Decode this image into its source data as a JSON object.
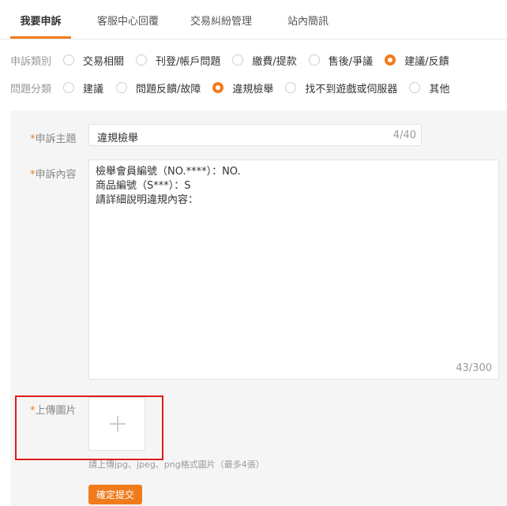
{
  "tabs": [
    {
      "label": "我要申訴",
      "active": true
    },
    {
      "label": "客服中心回覆",
      "active": false
    },
    {
      "label": "交易糾紛管理",
      "active": false
    },
    {
      "label": "站內簡訊",
      "active": false
    }
  ],
  "category": {
    "label": "申訴類別",
    "options": [
      "交易相關",
      "刊登/帳戶問題",
      "繳費/提款",
      "售後/爭議",
      "建議/反饋"
    ],
    "selected": "建議/反饋"
  },
  "issue_type": {
    "label": "問題分類",
    "options": [
      "建議",
      "問題反饋/故障",
      "違規檢舉",
      "找不到遊戲或伺服器",
      "其他"
    ],
    "selected": "違規檢舉"
  },
  "form": {
    "required_mark": "*",
    "subject_label": "申訴主題",
    "subject_value": "違規檢舉",
    "subject_count": "4/40",
    "content_label": "申訴內容",
    "content_lines": [
      "檢舉會員編號（NO.****）：NO.",
      "商品編號（S***）：S",
      "請詳細說明違規內容："
    ],
    "content_count": "43/300",
    "upload_label": "上傳圖片",
    "upload_hint": "請上傳jpg、jpeg、png格式圖片（最多4張）",
    "submit_label": "確定提交"
  },
  "colors": {
    "accent": "#f07b1d",
    "highlight_box": "#e01b1b"
  },
  "icons": {
    "upload": "plus-icon"
  }
}
